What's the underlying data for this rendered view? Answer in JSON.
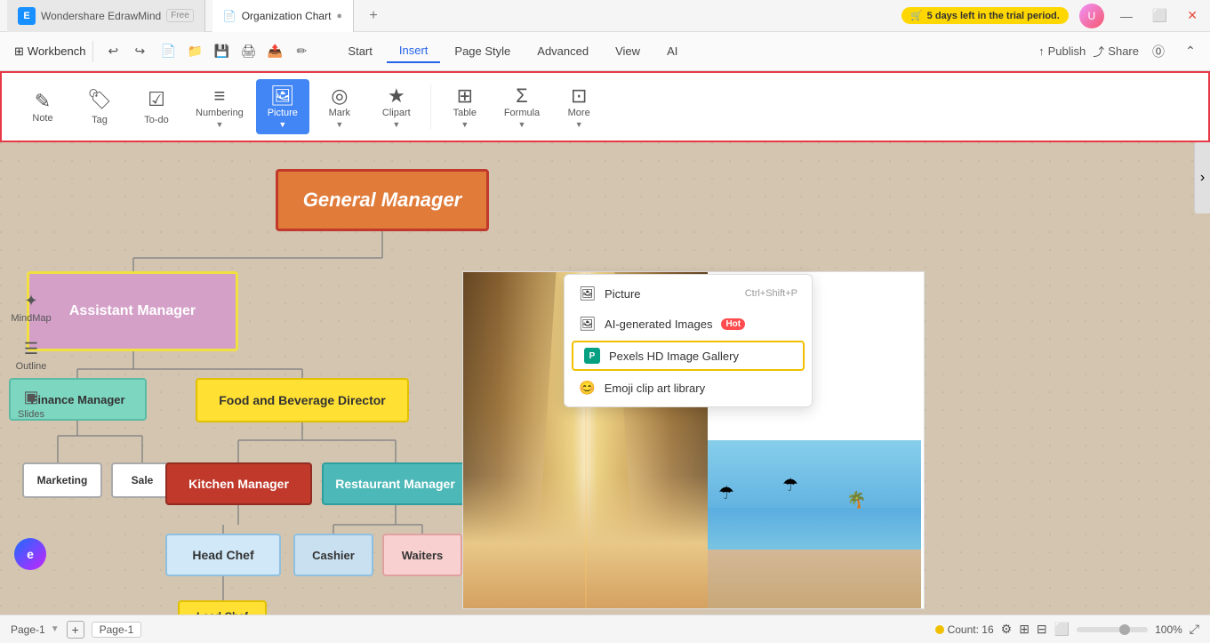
{
  "app": {
    "name": "Wondershare EdrawMind",
    "badge": "Free"
  },
  "tabs": [
    {
      "label": "Wondershare EdrawMind",
      "badge": "Free",
      "active": false
    },
    {
      "label": "Organization Chart",
      "active": true
    }
  ],
  "trial": {
    "text": "5 days left in the trial period."
  },
  "toolbar": {
    "workbench": "Workbench",
    "menus": [
      "Start",
      "Insert",
      "Page Style",
      "Advanced",
      "View",
      "AI"
    ],
    "active_menu": "Insert",
    "publish": "Publish",
    "share": "Share"
  },
  "ribbon": {
    "items": [
      {
        "id": "note",
        "label": "Note",
        "icon": "✎"
      },
      {
        "id": "tag",
        "label": "Tag",
        "icon": "🏷"
      },
      {
        "id": "todo",
        "label": "To-do",
        "icon": "☑"
      },
      {
        "id": "numbering",
        "label": "Numbering",
        "icon": "≡"
      },
      {
        "id": "picture",
        "label": "Picture",
        "icon": "🖼",
        "active": true,
        "highlight": true
      },
      {
        "id": "mark",
        "label": "Mark",
        "icon": "◎"
      },
      {
        "id": "clipart",
        "label": "Clipart",
        "icon": "★"
      },
      {
        "id": "table",
        "label": "Table",
        "icon": "⊞"
      },
      {
        "id": "formula",
        "label": "Formula",
        "icon": "Σ"
      },
      {
        "id": "more",
        "label": "More",
        "icon": "⊡"
      }
    ]
  },
  "sidebar_icons": [
    {
      "id": "mindmap",
      "label": "MindMap",
      "icon": "✦"
    },
    {
      "id": "outline",
      "label": "Outline",
      "icon": "☰"
    },
    {
      "id": "slides",
      "label": "Slides",
      "icon": "▣"
    }
  ],
  "dropdown": {
    "items": [
      {
        "id": "picture",
        "label": "Picture",
        "icon": "🖼",
        "shortcut": "Ctrl+Shift+P",
        "highlighted": false
      },
      {
        "id": "ai-images",
        "label": "AI-generated Images",
        "icon": "🖼",
        "badge": "Hot",
        "highlighted": false
      },
      {
        "id": "pexels",
        "label": "Pexels HD Image Gallery",
        "icon": "P",
        "highlighted": true
      },
      {
        "id": "emoji",
        "label": "Emoji clip art library",
        "icon": "😊",
        "highlighted": false
      }
    ]
  },
  "org_chart": {
    "title": "Organization Chart",
    "nodes": [
      {
        "id": "general-manager",
        "label": "General Manager"
      },
      {
        "id": "assistant-manager",
        "label": "Assistant Manager"
      },
      {
        "id": "finance-manager",
        "label": "Finance Manager"
      },
      {
        "id": "food-beverage",
        "label": "Food and Beverage Director"
      },
      {
        "id": "marketing",
        "label": "Marketing"
      },
      {
        "id": "sale",
        "label": "Sale"
      },
      {
        "id": "kitchen-manager",
        "label": "Kitchen Manager"
      },
      {
        "id": "restaurant-manager",
        "label": "Restaurant Manager"
      },
      {
        "id": "head-chef",
        "label": "Head Chef"
      },
      {
        "id": "cashier",
        "label": "Cashier"
      },
      {
        "id": "waiters",
        "label": "Waiters"
      },
      {
        "id": "lead-chef",
        "label": "Lead Chef"
      }
    ]
  },
  "status_bar": {
    "page_label": "Page-1",
    "page_tab": "Page-1",
    "count_label": "Count: 16",
    "zoom": "100%"
  }
}
